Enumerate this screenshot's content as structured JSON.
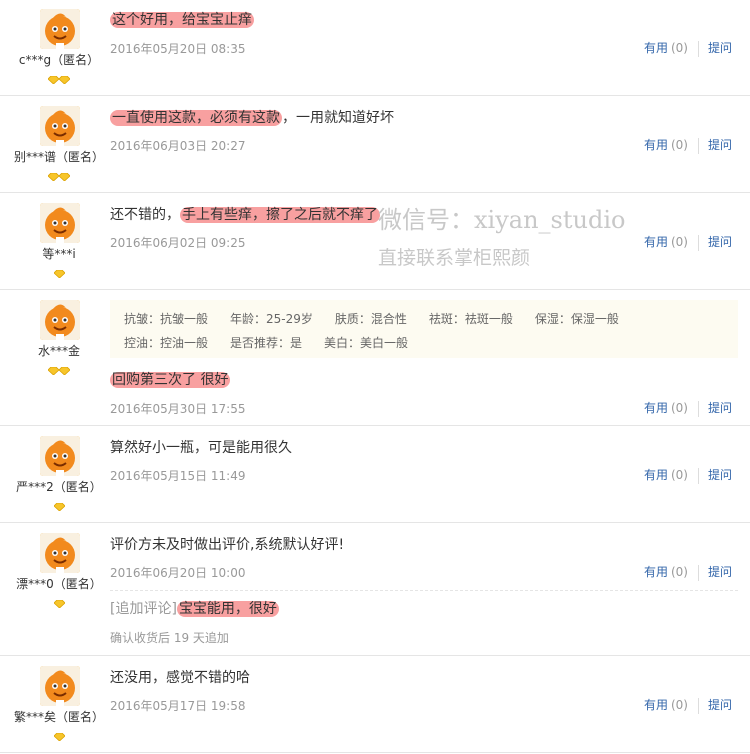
{
  "reviews": [
    {
      "user": "c***g（匿名）",
      "gems": 2,
      "content_before": "",
      "content_highlight": "这个好用，给宝宝止痒",
      "content_after": "",
      "date": "2016年05月20日 08:35",
      "useful_label": "有用",
      "useful_count": "(0)",
      "ask_label": "提问"
    },
    {
      "user": "别***谱（匿名）",
      "gems": 2,
      "content_before": "",
      "content_highlight": "一直使用这款，必须有这款",
      "content_after": "，一用就知道好坏",
      "date": "2016年06月03日 20:27",
      "useful_label": "有用",
      "useful_count": "(0)",
      "ask_label": "提问"
    },
    {
      "user": "等***i",
      "gems": 1,
      "content_before": "还不错的，",
      "content_highlight": "手上有些痒，擦了之后就不痒了",
      "content_after": "",
      "date": "2016年06月02日 09:25",
      "useful_label": "有用",
      "useful_count": "(0)",
      "ask_label": "提问"
    },
    {
      "user": "水***金",
      "gems": 2,
      "tags_row1": [
        "抗皱：抗皱一般",
        "年龄：25-29岁",
        "肤质：混合性",
        "祛斑：祛斑一般",
        "保湿：保湿一般"
      ],
      "tags_row2": [
        "控油：控油一般",
        "是否推荐：是",
        "美白：美白一般"
      ],
      "content_before": "",
      "content_highlight": "回购第三次了 很好",
      "content_after": "",
      "date": "2016年05月30日 17:55",
      "useful_label": "有用",
      "useful_count": "(0)",
      "ask_label": "提问"
    },
    {
      "user": "严***2（匿名）",
      "gems": 1,
      "content_before": "算然好小一瓶，可是能用很久",
      "content_highlight": "",
      "content_after": "",
      "date": "2016年05月15日 11:49",
      "useful_label": "有用",
      "useful_count": "(0)",
      "ask_label": "提问"
    },
    {
      "user": "漂***0（匿名）",
      "gems": 1,
      "content_before": "评价方未及时做出评价,系统默认好评!",
      "content_highlight": "",
      "content_after": "",
      "date": "2016年06月20日 10:00",
      "useful_label": "有用",
      "useful_count": "(0)",
      "ask_label": "提问",
      "append_label": "[追加评论]",
      "append_highlight": "宝宝能用，很好",
      "append_note": "确认收货后 19 天追加"
    },
    {
      "user": "繁***矣（匿名）",
      "gems": 1,
      "content_before": "还没用，感觉不错的哈",
      "content_highlight": "",
      "content_after": "",
      "date": "2016年05月17日 19:58",
      "useful_label": "有用",
      "useful_count": "(0)",
      "ask_label": "提问"
    }
  ],
  "watermark": {
    "line1": "微信号：xiyan_studio",
    "line2": "直接联系掌柜熙颜"
  },
  "colors": {
    "highlight": "#f8a0a0",
    "link": "#3366aa",
    "avatar": "#f5a623",
    "gem": "#f7c52a"
  }
}
